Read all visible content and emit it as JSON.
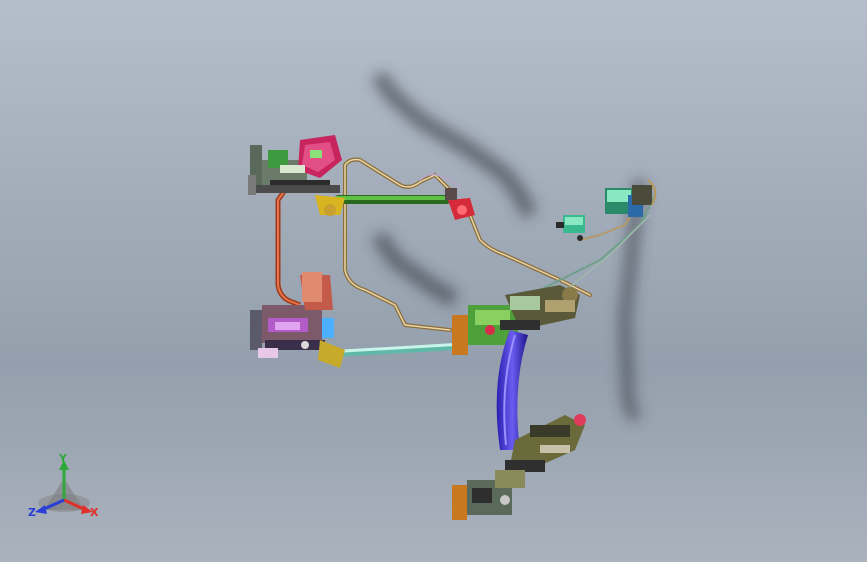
{
  "scene": {
    "description_visible": false,
    "background_top": "#b5bfcb",
    "background_bottom": "#949fad"
  },
  "triad": {
    "x_label": "X",
    "y_label": "Y",
    "z_label": "Z",
    "x_color": "#e0302a",
    "y_color": "#2faa3a",
    "z_color": "#2a3fd6"
  },
  "icons": [
    "coordinate-triad-icon"
  ]
}
